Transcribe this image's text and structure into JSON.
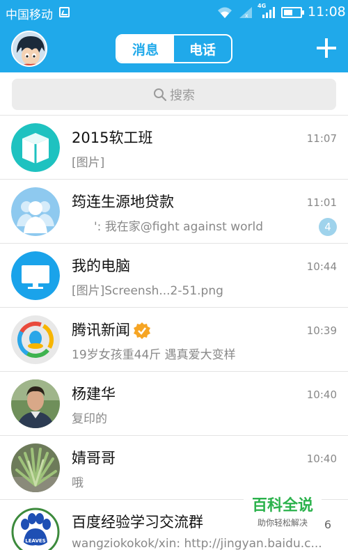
{
  "status_bar": {
    "carrier": "中国移动",
    "network": "4G",
    "time": "11:08"
  },
  "header": {
    "tabs": [
      {
        "label": "消息",
        "active": true
      },
      {
        "label": "电话",
        "active": false
      }
    ],
    "accent_color": "#20a9ea"
  },
  "search": {
    "placeholder": "搜索"
  },
  "chats": [
    {
      "name": "2015软工班",
      "preview": "[图片]",
      "time": "11:07",
      "avatar": "book-icon",
      "badge": null
    },
    {
      "name": "筠连生源地贷款",
      "preview": "': 我在家@fight against world",
      "time": "11:01",
      "avatar": "group-icon",
      "badge": "4"
    },
    {
      "name": "我的电脑",
      "preview": "[图片]Screensh...2-51.png",
      "time": "10:44",
      "avatar": "monitor-icon",
      "badge": null
    },
    {
      "name": "腾讯新闻",
      "preview": "19岁女孩重44斤 遇真爱大变样",
      "time": "10:39",
      "avatar": "news-app-icon",
      "badge": null,
      "verified": true
    },
    {
      "name": "杨建华",
      "preview": "复印的",
      "time": "10:40",
      "avatar": "person-photo",
      "badge": null
    },
    {
      "name": "婧哥哥",
      "preview": "哦",
      "time": "10:40",
      "avatar": "plant-photo",
      "badge": null
    },
    {
      "name": "百度经验学习交流群",
      "preview": "wangziokokok/xin: http://jingyan.baidu.c...",
      "time": "",
      "avatar": "paw-icon",
      "badge": "6"
    }
  ],
  "watermark": {
    "title": "百科全说",
    "subtitle": "助你轻松解决"
  }
}
